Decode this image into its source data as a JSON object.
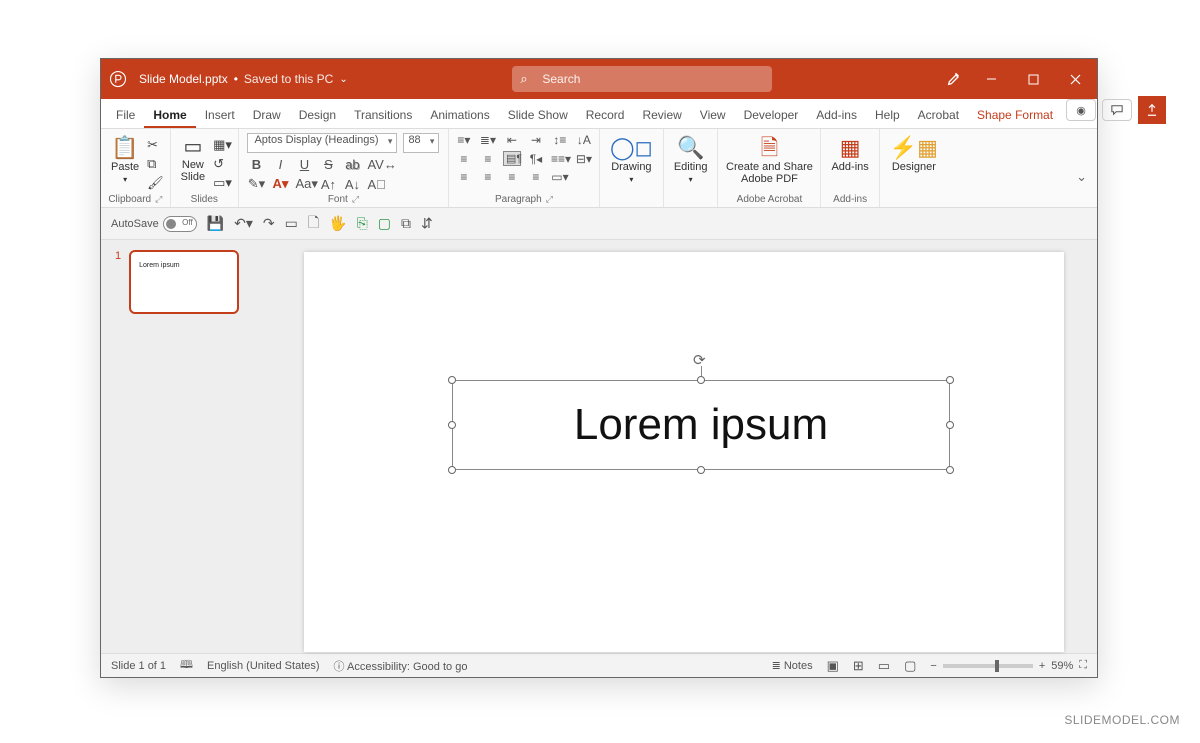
{
  "title": {
    "filename": "Slide Model.pptx",
    "savestate": "Saved to this PC",
    "search_placeholder": "Search"
  },
  "tabs": {
    "items": [
      "File",
      "Home",
      "Insert",
      "Draw",
      "Design",
      "Transitions",
      "Animations",
      "Slide Show",
      "Record",
      "Review",
      "View",
      "Developer",
      "Add-ins",
      "Help",
      "Acrobat"
    ],
    "context": "Shape Format",
    "active": "Home"
  },
  "ribbon": {
    "clipboard": {
      "paste": "Paste",
      "label": "Clipboard"
    },
    "slides": {
      "newslide": "New\nSlide",
      "label": "Slides"
    },
    "font": {
      "family": "Aptos Display (Headings)",
      "size": "88",
      "label": "Font"
    },
    "paragraph": {
      "label": "Paragraph"
    },
    "drawing": {
      "label": "Drawing"
    },
    "editing": {
      "label": "Editing"
    },
    "acrobat": {
      "btn": "Create and Share\nAdobe PDF",
      "label": "Adobe Acrobat"
    },
    "addins": {
      "btn": "Add-ins",
      "label": "Add-ins"
    },
    "designer": {
      "btn": "Designer"
    }
  },
  "qat": {
    "autosave": "AutoSave",
    "off": "Off"
  },
  "thumb": {
    "num": "1",
    "text": "Lorem ipsum"
  },
  "slide": {
    "text": "Lorem ipsum"
  },
  "status": {
    "slide": "Slide 1 of 1",
    "lang": "English (United States)",
    "access": "Accessibility: Good to go",
    "notes": "Notes",
    "zoom": "59%"
  },
  "watermark": "SLIDEMODEL.COM"
}
